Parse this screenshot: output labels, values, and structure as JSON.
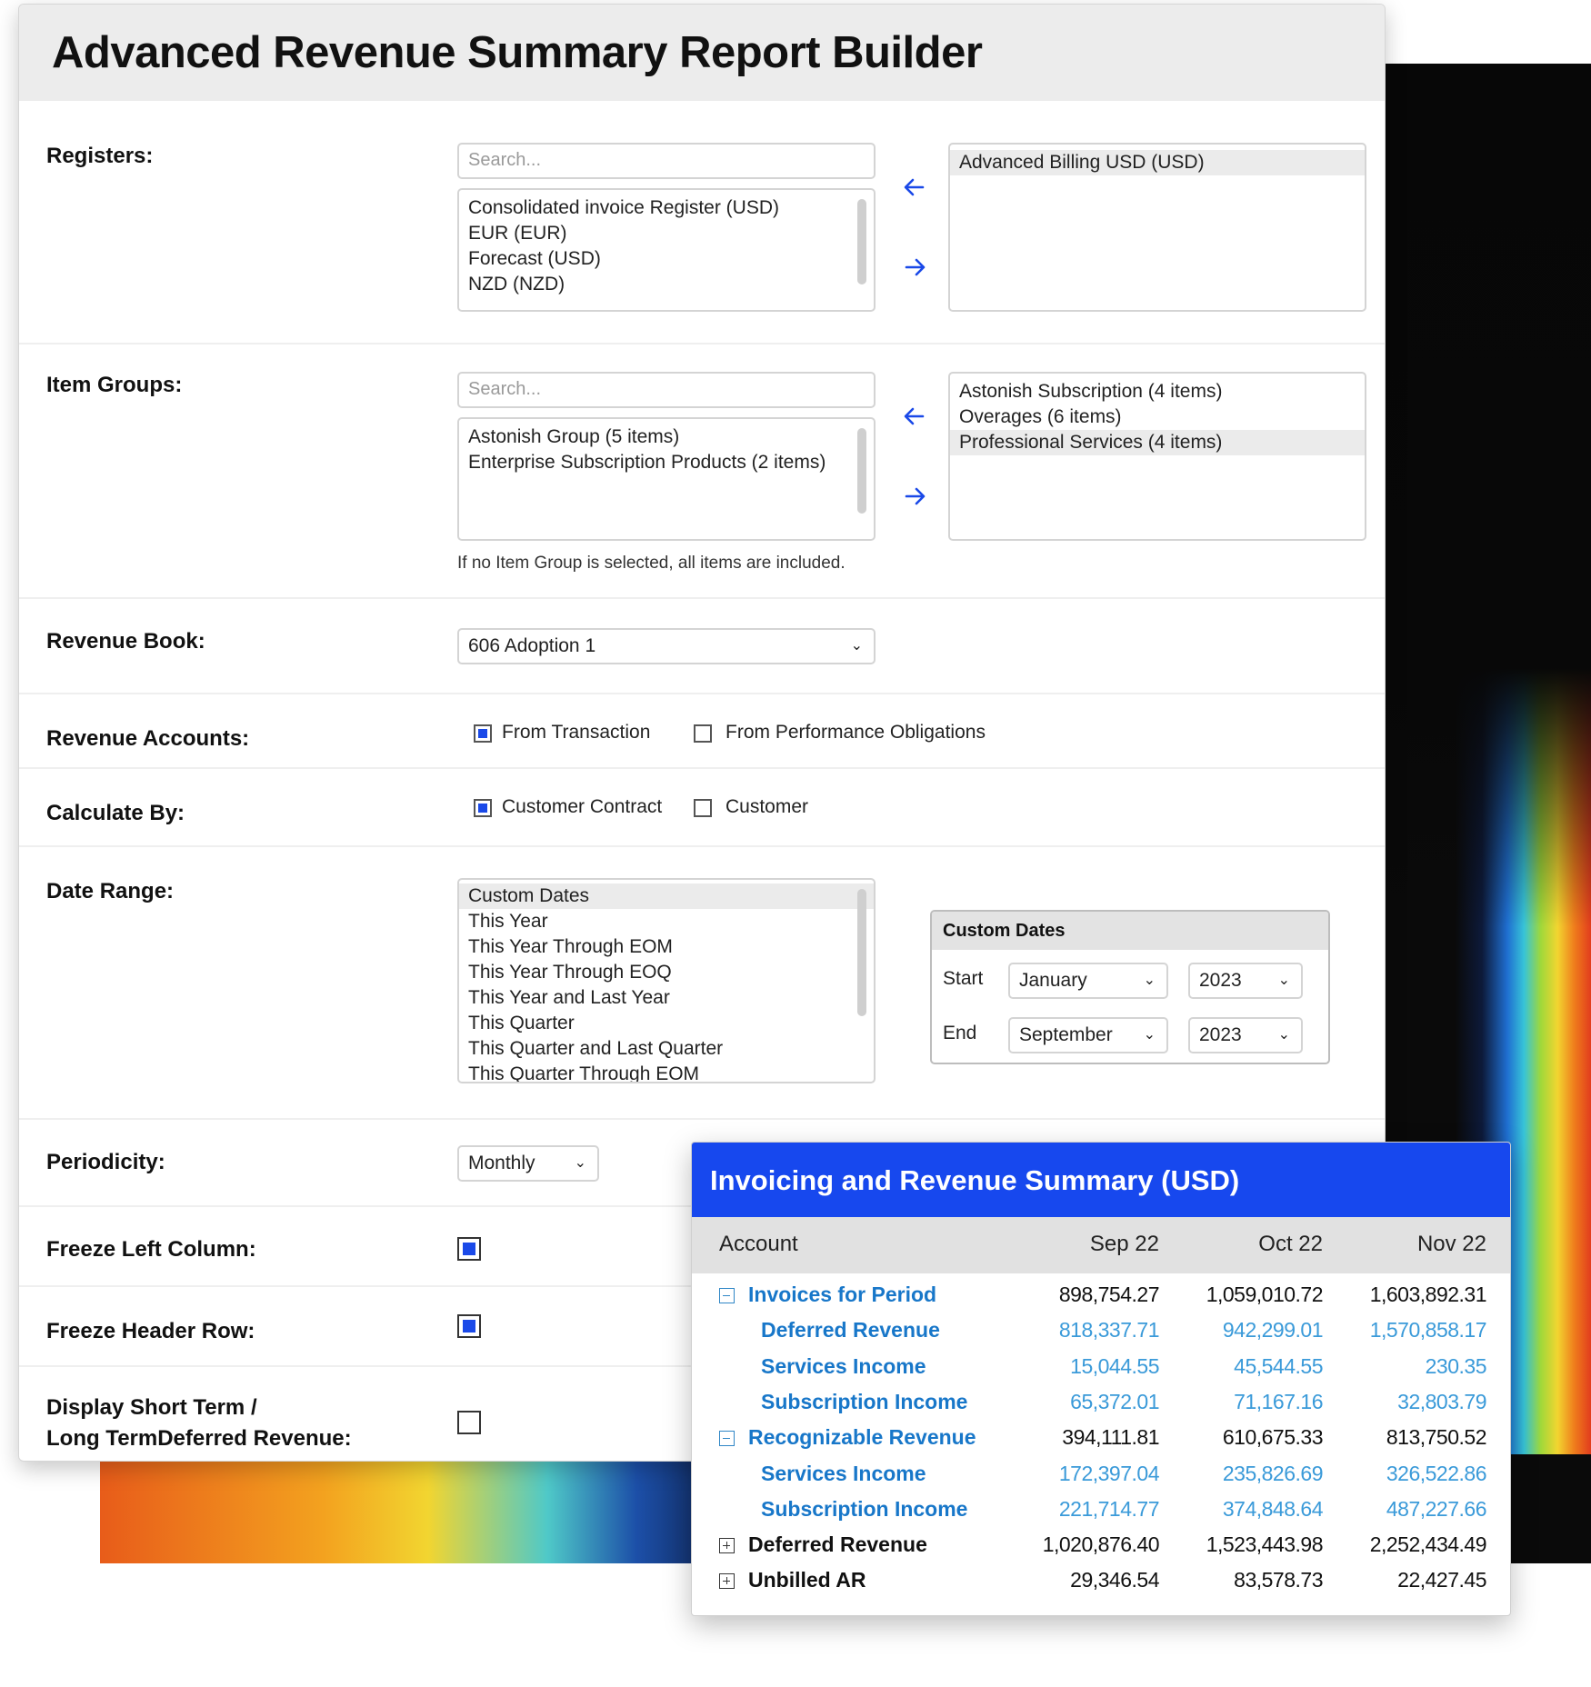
{
  "title": "Advanced Revenue Summary Report Builder",
  "registers": {
    "label": "Registers:",
    "search_placeholder": "Search...",
    "available": [
      "Consolidated invoice Register (USD)",
      "EUR (EUR)",
      "Forecast (USD)",
      "NZD (NZD)"
    ],
    "selected": [
      "Advanced Billing USD (USD)"
    ]
  },
  "item_groups": {
    "label": "Item Groups:",
    "search_placeholder": "Search...",
    "available": [
      "Astonish Group (5 items)",
      "Enterprise Subscription Products (2 items)"
    ],
    "selected": [
      "Astonish Subscription (4 items)",
      "Overages (6 items)",
      "Professional Services (4 items)"
    ],
    "hint": "If no Item Group is selected, all items are included."
  },
  "revenue_book": {
    "label": "Revenue Book:",
    "value": "606 Adoption 1"
  },
  "revenue_accounts": {
    "label": "Revenue Accounts:",
    "options": [
      {
        "label": "From Transaction",
        "checked": true
      },
      {
        "label": "From Performance Obligations",
        "checked": false
      }
    ]
  },
  "calculate_by": {
    "label": "Calculate By:",
    "options": [
      {
        "label": "Customer Contract",
        "checked": true
      },
      {
        "label": "Customer",
        "checked": false
      }
    ]
  },
  "date_range": {
    "label": "Date Range:",
    "options": [
      "Custom Dates",
      "This Year",
      "This Year Through EOM",
      "This Year Through EOQ",
      "This Year and Last Year",
      "This Quarter",
      "This Quarter and Last Quarter",
      "This Quarter Through EOM"
    ],
    "selected": "Custom Dates"
  },
  "custom_dates": {
    "title": "Custom Dates",
    "start_label": "Start",
    "start_month": "January",
    "start_year": "2023",
    "end_label": "End",
    "end_month": "September",
    "end_year": "2023"
  },
  "periodicity": {
    "label": "Periodicity:",
    "value": "Monthly"
  },
  "freeze_left_column": {
    "label": "Freeze Left Column:",
    "checked": true
  },
  "freeze_header_row": {
    "label": "Freeze Header Row:",
    "checked": true
  },
  "display_short_long": {
    "label_line1": "Display Short Term /",
    "label_line2": "Long TermDeferred Revenue:",
    "checked": false
  },
  "summary": {
    "title": "Invoicing and Revenue Summary (USD)",
    "columns": [
      "Account",
      "Sep 22",
      "Oct 22",
      "Nov 22"
    ],
    "rows": [
      {
        "name": "Invoices for Period",
        "toggle": "minus",
        "level": 0,
        "values": [
          "898,754.27",
          "1,059,010.72",
          "1,603,892.31"
        ]
      },
      {
        "name": "Deferred Revenue",
        "toggle": "",
        "level": 1,
        "values": [
          "818,337.71",
          "942,299.01",
          "1,570,858.17"
        ]
      },
      {
        "name": "Services Income",
        "toggle": "",
        "level": 1,
        "values": [
          "15,044.55",
          "45,544.55",
          "230.35"
        ]
      },
      {
        "name": "Subscription Income",
        "toggle": "",
        "level": 1,
        "values": [
          "65,372.01",
          "71,167.16",
          "32,803.79"
        ]
      },
      {
        "name": "Recognizable Revenue",
        "toggle": "minus",
        "level": 0,
        "values": [
          "394,111.81",
          "610,675.33",
          "813,750.52"
        ]
      },
      {
        "name": "Services Income",
        "toggle": "",
        "level": 1,
        "values": [
          "172,397.04",
          "235,826.69",
          "326,522.86"
        ]
      },
      {
        "name": "Subscription Income",
        "toggle": "",
        "level": 1,
        "values": [
          "221,714.77",
          "374,848.64",
          "487,227.66"
        ]
      },
      {
        "name": "Deferred Revenue",
        "toggle": "plus",
        "level": 2,
        "values": [
          "1,020,876.40",
          "1,523,443.98",
          "2,252,434.49"
        ]
      },
      {
        "name": "Unbilled AR",
        "toggle": "plus",
        "level": 2,
        "values": [
          "29,346.54",
          "83,578.73",
          "22,427.45"
        ]
      }
    ]
  },
  "colors": {
    "accent": "#1a49e8",
    "card_header": "#1748ee",
    "link_blue": "#1877c9",
    "value_blue": "#3a9ad9"
  },
  "icons": {
    "left_arrow": "arrow-left-icon",
    "right_arrow": "arrow-right-icon",
    "chevron": "chevron-down-icon"
  }
}
